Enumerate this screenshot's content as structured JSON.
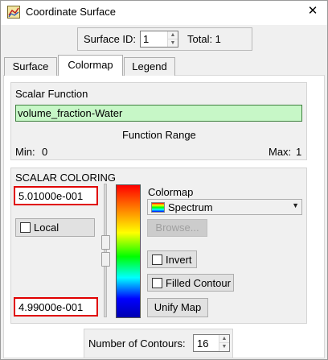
{
  "window": {
    "title": "Coordinate Surface",
    "close_glyph": "✕"
  },
  "surface_id": {
    "label": "Surface ID:",
    "value": "1",
    "total_label": "Total: 1"
  },
  "tabs": [
    {
      "label": "Surface",
      "active": false
    },
    {
      "label": "Colormap",
      "active": true
    },
    {
      "label": "Legend",
      "active": false
    }
  ],
  "scalar_function": {
    "title": "Scalar Function",
    "value": "volume_fraction-Water",
    "range_title": "Function Range",
    "min_label": "Min:",
    "min_value": "0",
    "max_label": "Max:",
    "max_value": "1"
  },
  "scalar_coloring": {
    "title": "SCALAR COLORING",
    "max_value": "5.01000e-001",
    "min_value": "4.99000e-001",
    "local_label": "Local",
    "local_checked": false,
    "colormap_label": "Colormap",
    "colormap_selected": "Spectrum",
    "browse_label": "Browse...",
    "invert_label": "Invert",
    "invert_checked": false,
    "filled_contour_label": "Filled Contour",
    "filled_contour_checked": false,
    "unify_map_label": "Unify Map",
    "contours_label": "Number of Contours:",
    "contours_value": "16"
  },
  "icons": {
    "app": "coordinate-surface-app-icon",
    "colormap": "spectrum-icon",
    "close": "close-icon"
  },
  "colors": {
    "function_field_bg": "#c7f7c7",
    "highlight_border": "#e00000"
  }
}
